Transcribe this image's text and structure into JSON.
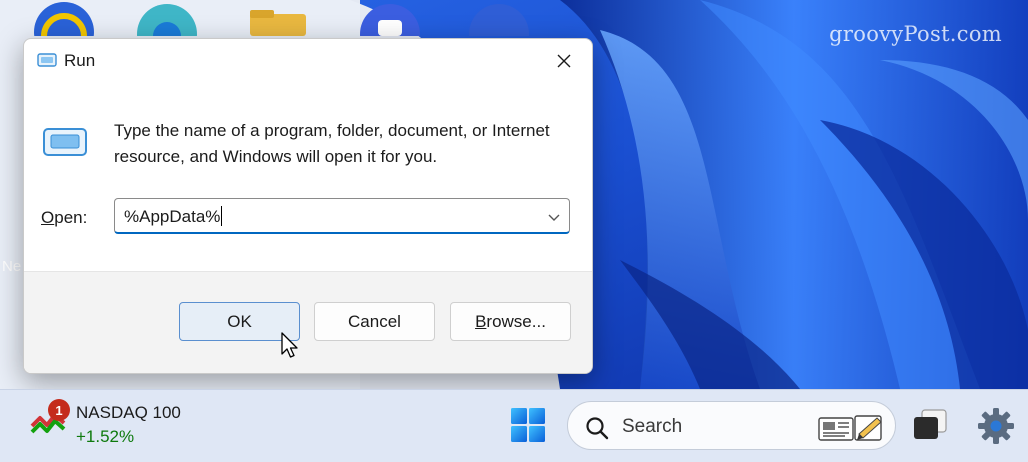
{
  "desktop": {
    "watermark": "groovyPost.com",
    "partial_label": "Ne"
  },
  "dialog": {
    "title": "Run",
    "description": "Type the name of a program, folder, document, or Internet resource, and Windows will open it for you.",
    "open_label_access_key": "O",
    "open_label_rest": "pen:",
    "open_value": "%AppData%",
    "ok_label": "OK",
    "cancel_label": "Cancel",
    "browse_access_key": "B",
    "browse_rest": "rowse..."
  },
  "taskbar": {
    "widget": {
      "badge": "1",
      "name": "NASDAQ 100",
      "value": "+1.52%"
    },
    "search_label": "Search"
  },
  "colors": {
    "accent": "#0067c0",
    "wallpaper": "#1f57d6",
    "taskbar": "#dfe7f5",
    "stock_up": "#0e7a0d",
    "badge": "#c42b1c"
  },
  "icons": [
    "run-icon",
    "close-icon",
    "chevron-down-icon",
    "stock-chart-icon",
    "windows-start-icon",
    "search-icon",
    "news-icon",
    "task-view-icon",
    "gear-icon",
    "mouse-pointer-icon"
  ]
}
